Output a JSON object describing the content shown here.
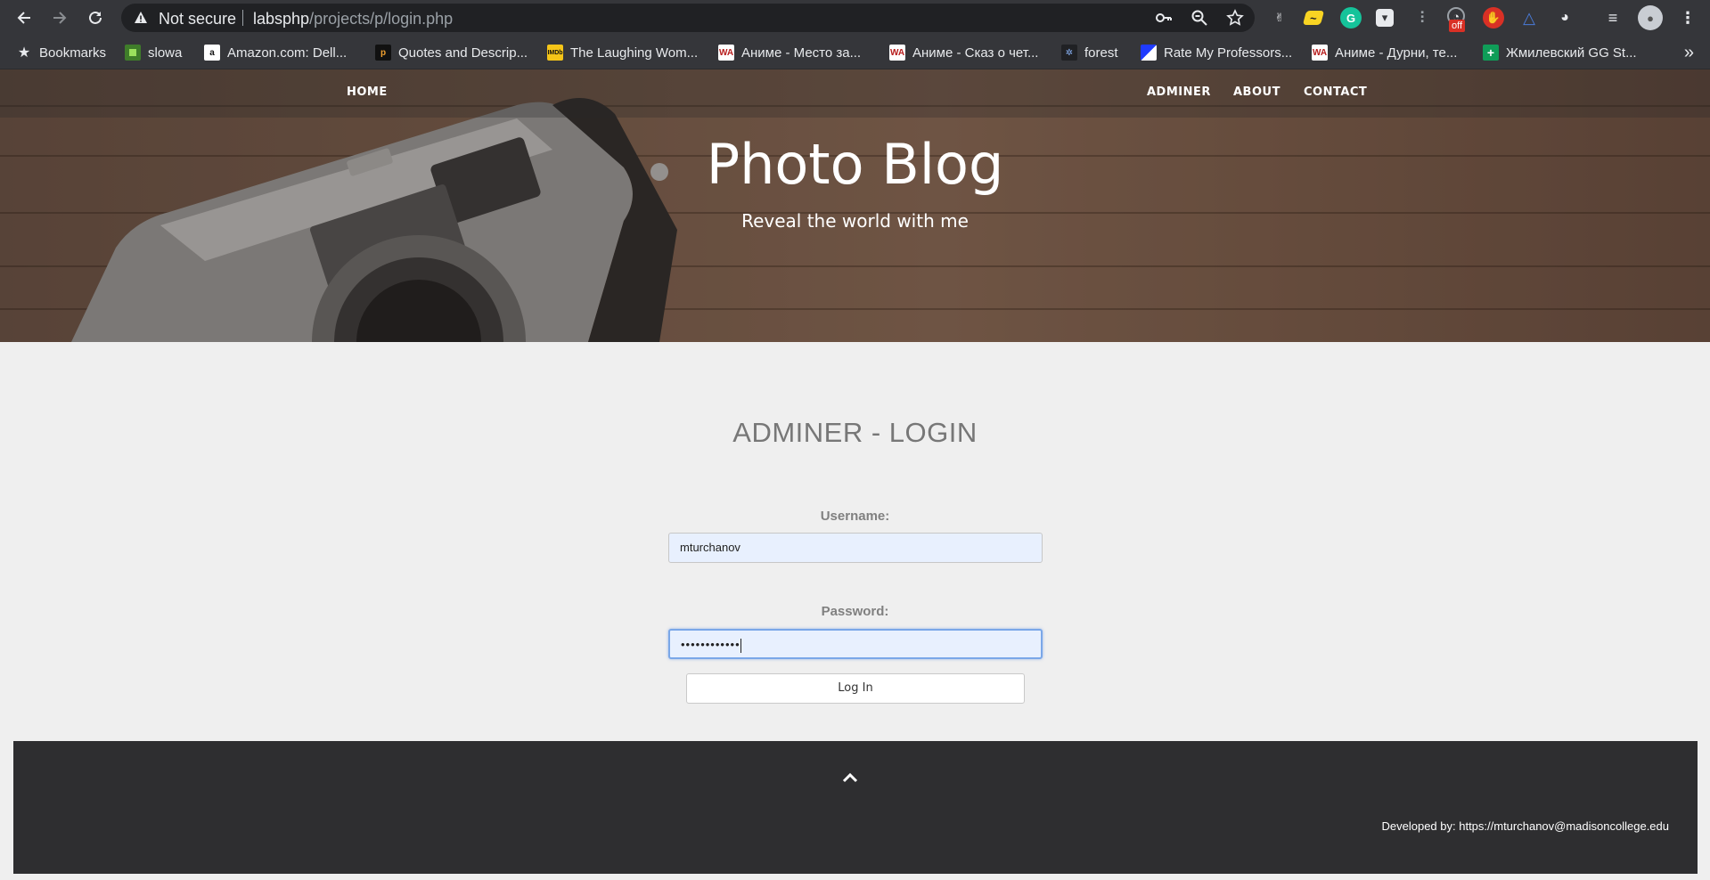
{
  "browser": {
    "security_label": "Not secure",
    "url_host": "labsphp",
    "url_path": "/projects/p/login.php",
    "extension_badge": "off",
    "bookmarks": [
      {
        "label": "Bookmarks",
        "icon": "star-icon"
      },
      {
        "label": "slowa",
        "icon": "green-square-icon"
      },
      {
        "label": "Amazon.com: Dell...",
        "icon": "amazon-icon"
      },
      {
        "label": "Quotes and Descrip...",
        "icon": "quotes-icon"
      },
      {
        "label": "The Laughing Wom...",
        "icon": "imdb-icon"
      },
      {
        "label": "Аниме - Место за...",
        "icon": "wa-icon"
      },
      {
        "label": "Аниме - Сказ о чет...",
        "icon": "wa-icon"
      },
      {
        "label": "forest",
        "icon": "snowflake-icon"
      },
      {
        "label": "Rate My Professors...",
        "icon": "rmp-icon"
      },
      {
        "label": "Аниме - Дурни, те...",
        "icon": "wa-icon"
      },
      {
        "label": "Жмилевский GG St...",
        "icon": "sheets-icon"
      }
    ]
  },
  "site": {
    "nav": {
      "home": "HOME",
      "adminer": "ADMINER",
      "about": "ABOUT",
      "contact": "CONTACT"
    },
    "title": "Photo Blog",
    "subtitle": "Reveal the world with me"
  },
  "login": {
    "heading": "ADMINER - LOGIN",
    "username_label": "Username:",
    "username_value": "mturchanov",
    "password_label": "Password:",
    "password_masked": "••••••••••••",
    "submit_label": "Log In"
  },
  "footer": {
    "credit": "Developed by: https://mturchanov@madisoncollege.edu"
  },
  "colors": {
    "hero_wood": "#7b5e4b",
    "footer_bg": "#2e2e30",
    "focus_border": "#7aa7e8"
  }
}
